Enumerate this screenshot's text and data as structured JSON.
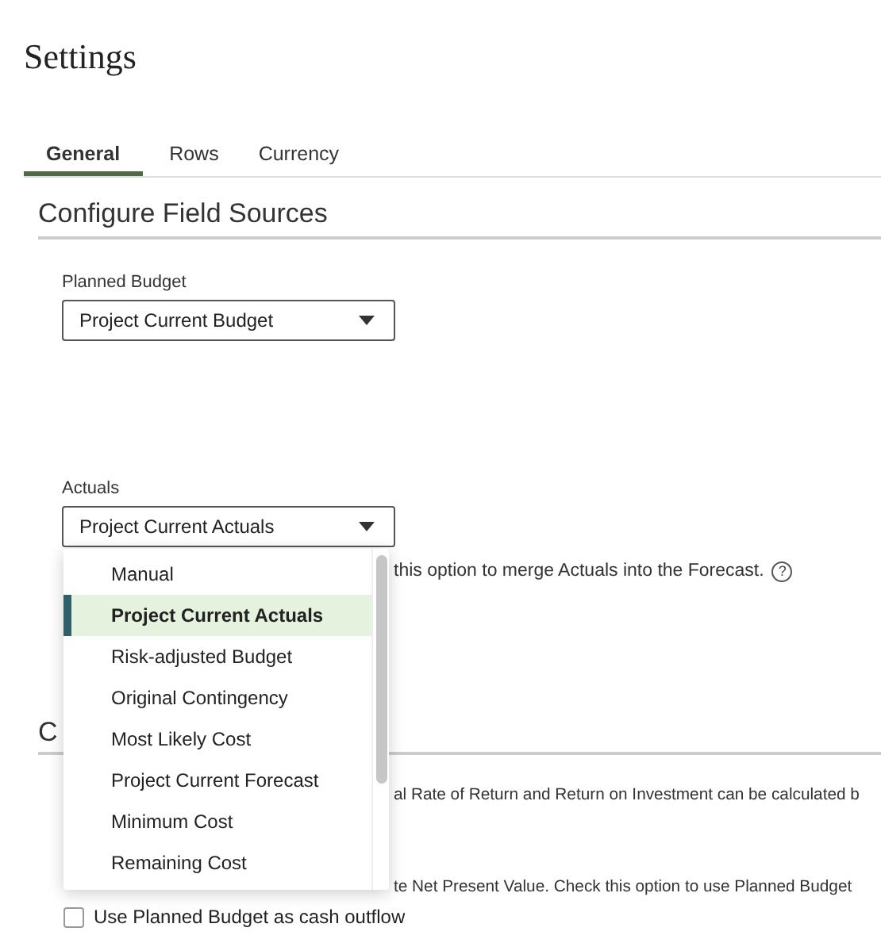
{
  "page": {
    "title": "Settings"
  },
  "tabs": [
    {
      "label": "General",
      "selected": true
    },
    {
      "label": "Rows",
      "selected": false
    },
    {
      "label": "Currency",
      "selected": false
    }
  ],
  "field_sources": {
    "heading": "Configure Field Sources",
    "planned_budget": {
      "label": "Planned Budget",
      "value": "Project Current Budget"
    },
    "actuals": {
      "label": "Actuals",
      "value": "Project Current Actuals",
      "expanded": true,
      "options": [
        {
          "label": "Manual",
          "selected": false
        },
        {
          "label": "Project Current Actuals",
          "selected": true
        },
        {
          "label": "Risk-adjusted Budget",
          "selected": false
        },
        {
          "label": "Original Contingency",
          "selected": false
        },
        {
          "label": "Most Likely Cost",
          "selected": false
        },
        {
          "label": "Project Current Forecast",
          "selected": false
        },
        {
          "label": "Minimum Cost",
          "selected": false
        },
        {
          "label": "Remaining Cost",
          "selected": false
        }
      ]
    },
    "help_text": "this option to merge Actuals into the Forecast.",
    "help_icon": "?"
  },
  "section_2": {
    "heading": "C",
    "text_1": "al Rate of Return and Return on Investment can be calculated b",
    "text_2": "te Net Present Value. Check this option to use Planned Budget",
    "checkbox": {
      "label": "Use Planned Budget as cash outflow",
      "checked": false
    }
  }
}
